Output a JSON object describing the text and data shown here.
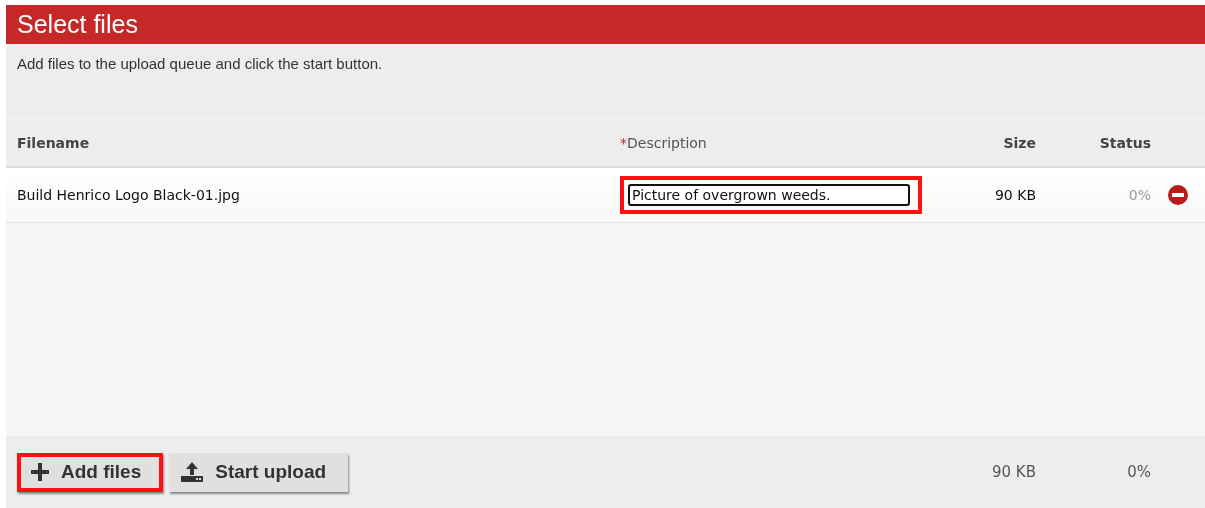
{
  "header": {
    "title": "Select files"
  },
  "instructions": "Add files to the upload queue and click the start button.",
  "table": {
    "columns": [
      {
        "label": "Filename"
      },
      {
        "label": "Description",
        "required_mark": "*"
      },
      {
        "label": "Size"
      },
      {
        "label": "Status"
      }
    ],
    "rows": [
      {
        "filename": "Build Henrico Logo Black-01.jpg",
        "description": "Picture of overgrown weeds.",
        "highlighted": true,
        "size": "90 KB",
        "status": "0%"
      }
    ]
  },
  "footer": {
    "buttons": [
      {
        "label": "Add files",
        "kind": "add",
        "highlighted": true
      },
      {
        "label": "Start upload",
        "kind": "upload",
        "highlighted": false
      }
    ],
    "total_size": "90 KB",
    "total_status": "0%"
  }
}
